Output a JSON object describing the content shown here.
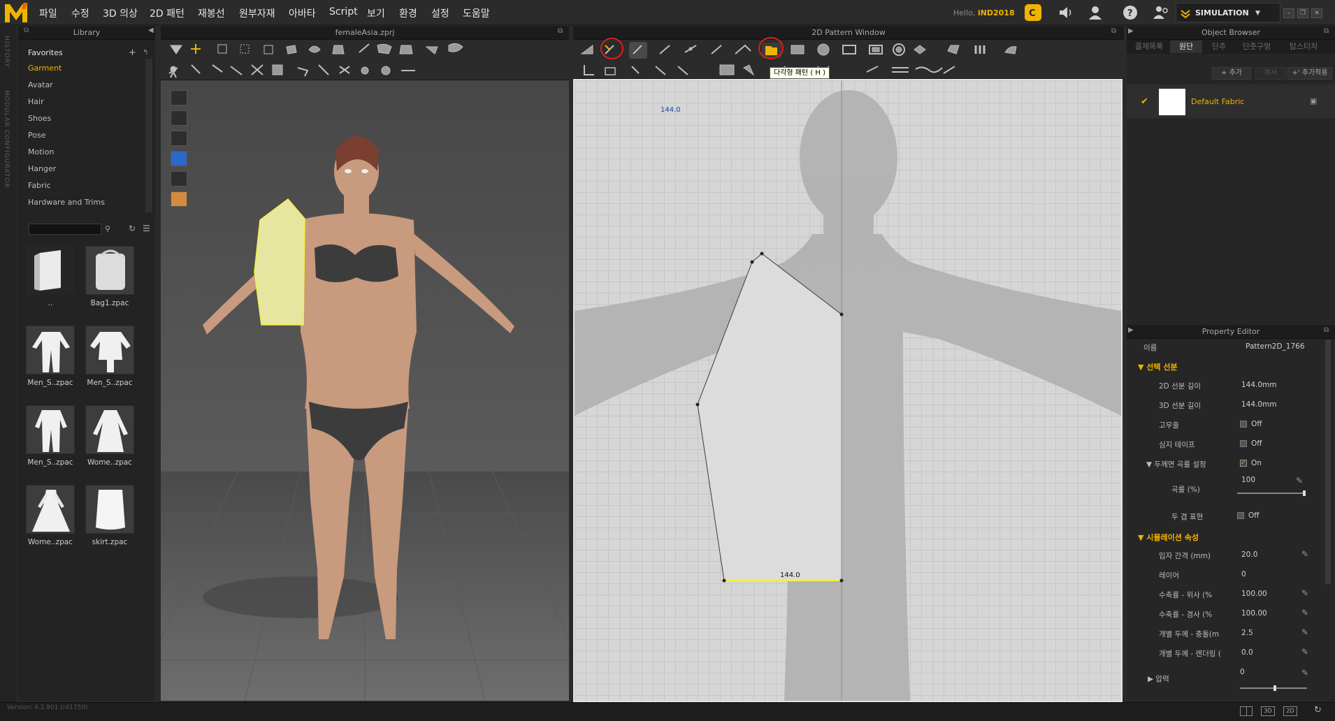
{
  "menubar": {
    "logo_text": "M",
    "items": [
      "파일",
      "수정",
      "3D 의상",
      "2D 패턴",
      "재봉선",
      "원부자재",
      "아바타",
      "Script",
      "보기",
      "환경",
      "설정",
      "도움말"
    ],
    "hello_prefix": "Hello,",
    "username": "iND2018",
    "simulation_label": "SIMULATION"
  },
  "side_strip": {
    "history": "HISTORY",
    "modular": "MODULAR CONFIGURATOR"
  },
  "library": {
    "title": "Library",
    "categories": [
      "Favorites",
      "Garment",
      "Avatar",
      "Hair",
      "Shoes",
      "Pose",
      "Motion",
      "Hanger",
      "Fabric",
      "Hardware and Trims"
    ],
    "selected_category": "Garment",
    "files": [
      {
        "label": ".."
      },
      {
        "label": "Bag1.zpac"
      },
      {
        "label": "Men_S..zpac"
      },
      {
        "label": "Men_S..zpac"
      },
      {
        "label": "Men_S..zpac"
      },
      {
        "label": "Wome..zpac"
      },
      {
        "label": "Wome..zpac"
      },
      {
        "label": "skirt.zpac"
      }
    ]
  },
  "viewport3d": {
    "title": "femaleAsia.zprj"
  },
  "viewport2d": {
    "title": "2D Pattern Window",
    "tooltip": "다각형 패턴 ( H )",
    "measure_top": "144.0",
    "measure_bottom": "144.0"
  },
  "object_browser": {
    "title": "Object Browser",
    "tabs": [
      "콜제목록",
      "원단",
      "단추",
      "단춧구멍",
      "탑스티치"
    ],
    "active_tab": "원단",
    "add_label": "+ 추가",
    "copy_label": "복사",
    "add_apply_label": "+' 추가적용",
    "fabric_name": "Default Fabric"
  },
  "property_editor": {
    "title": "Property Editor",
    "name_label": "이름",
    "name_value": "Pattern2D_1766",
    "section1": "선택 선분",
    "rows1": [
      {
        "label": "2D 선분 길이",
        "value": "144.0mm"
      },
      {
        "label": "3D 선분 길이",
        "value": "144.0mm"
      },
      {
        "label": "고무줄",
        "value": "Off"
      },
      {
        "label": "심지 테이프",
        "value": "Off"
      },
      {
        "label": "두께면 곡률 설정",
        "value": "On"
      },
      {
        "label": "곡률 (%)",
        "value": "100"
      },
      {
        "label": "두 겹 표현",
        "value": "Off"
      }
    ],
    "section2": "시뮬레이션 속성",
    "rows2": [
      {
        "label": "입자 간격 (mm)",
        "value": "20.0"
      },
      {
        "label": "레이어",
        "value": "0"
      },
      {
        "label": "수축률 - 위사 (%",
        "value": "100.00"
      },
      {
        "label": "수축률 - 경사 (%",
        "value": "100.00"
      },
      {
        "label": "개별 두께 - 충돌(m",
        "value": "2.5"
      },
      {
        "label": "개별 두께 - 렌더링 (",
        "value": "0.0"
      },
      {
        "label": "압력",
        "value": "0"
      }
    ]
  },
  "status": {
    "version": "Version: 4.2.801 (r41750)"
  },
  "colors": {
    "accent": "#f0b400",
    "pattern_fill": "#e6e6a0",
    "canvas": "#d6d6d6"
  }
}
